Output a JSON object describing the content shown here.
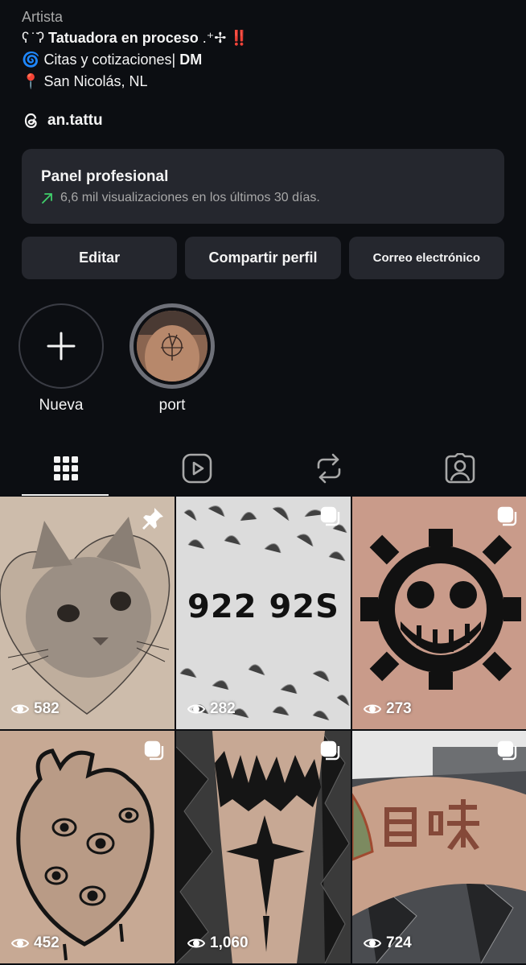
{
  "profile": {
    "category": "Artista",
    "bio_line1_prefix": "ʕ⁠ ̇ ̇⁠ʔ",
    "bio_line1_bold": "Tatuadora en proceso",
    "bio_line1_suffix": ".⁺✢",
    "bio_line1_mark": "‼️",
    "bio_line2_icon": "🌀",
    "bio_line2_text": "Citas y cotizaciones|",
    "bio_line2_bold": "DM",
    "bio_line3_icon": "📍",
    "bio_line3_text": "San Nicolás, NL",
    "threads_handle": "an.tattu",
    "threads_icon": "threads-icon"
  },
  "panel": {
    "title": "Panel profesional",
    "subtitle": "6,6 mil visualizaciones en los últimos 30 días.",
    "trend_color": "#3fd06b"
  },
  "buttons": {
    "edit": "Editar",
    "share": "Compartir perfil",
    "email": "Correo electrónico"
  },
  "highlights": [
    {
      "label": "Nueva",
      "icon": "plus-icon"
    },
    {
      "label": "port"
    }
  ],
  "tabs": [
    {
      "name": "grid",
      "icon": "grid-icon",
      "active": true
    },
    {
      "name": "reels",
      "icon": "reels-icon",
      "active": false
    },
    {
      "name": "reposts",
      "icon": "repost-icon",
      "active": false
    },
    {
      "name": "tagged",
      "icon": "tagged-icon",
      "active": false
    }
  ],
  "posts": [
    {
      "views": "582",
      "badge": "pin-icon"
    },
    {
      "views": "282",
      "badge": "carousel-icon",
      "tattoo_text": "922 92S"
    },
    {
      "views": "273",
      "badge": "carousel-icon"
    },
    {
      "views": "452",
      "badge": "carousel-icon"
    },
    {
      "views": "1,060",
      "badge": "carousel-icon"
    },
    {
      "views": "724",
      "badge": "carousel-icon"
    }
  ]
}
